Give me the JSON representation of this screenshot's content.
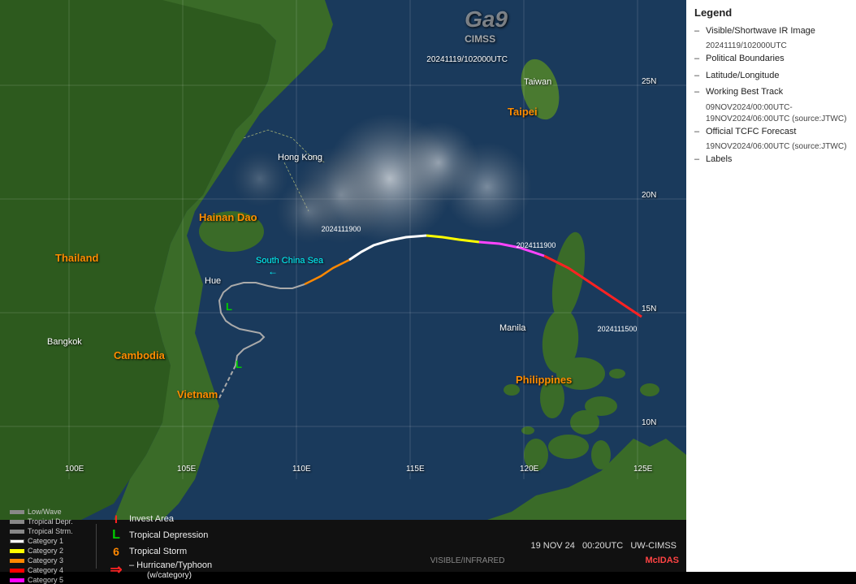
{
  "legend": {
    "title": "Legend",
    "items": [
      {
        "id": "visible-ir",
        "label": "Visible/Shortwave IR Image",
        "sub": "20241119/102000UTC"
      },
      {
        "id": "political",
        "label": "Political Boundaries"
      },
      {
        "id": "latlng",
        "label": "Latitude/Longitude"
      },
      {
        "id": "best-track",
        "label": "Working Best Track",
        "sub": "09NOV2024/00:00UTC-\n19NOV2024/06:00UTC  (source:JTWC)"
      },
      {
        "id": "official-forecast",
        "label": "Official TCFC Forecast",
        "sub": "19NOV2024/06:00UTC  (source:JTWC)"
      },
      {
        "id": "labels",
        "label": "Labels"
      }
    ]
  },
  "map": {
    "labels": [
      {
        "id": "taiwan",
        "text": "Taiwan",
        "color": "orange"
      },
      {
        "id": "taipei",
        "text": "Taipei",
        "color": "white"
      },
      {
        "id": "hong-kong",
        "text": "Hong Kong",
        "color": "white"
      },
      {
        "id": "hainan-dao",
        "text": "Hainan Dao",
        "color": "orange"
      },
      {
        "id": "south-china-sea",
        "text": "South China Sea",
        "color": "cyan"
      },
      {
        "id": "hue",
        "text": "Hue",
        "color": "white"
      },
      {
        "id": "thailand",
        "text": "Thailand",
        "color": "orange"
      },
      {
        "id": "bangkok",
        "text": "Bangkok",
        "color": "white"
      },
      {
        "id": "cambodia",
        "text": "Cambodia",
        "color": "orange"
      },
      {
        "id": "vietnam",
        "text": "Vietnam",
        "color": "orange"
      },
      {
        "id": "philippines",
        "text": "Philippines",
        "color": "orange"
      },
      {
        "id": "manila",
        "text": "Manila",
        "color": "white"
      },
      {
        "id": "25N",
        "text": "25N",
        "color": "white"
      },
      {
        "id": "20N",
        "text": "20N",
        "color": "white"
      },
      {
        "id": "15N",
        "text": "15N",
        "color": "white"
      },
      {
        "id": "100E",
        "text": "100E",
        "color": "white"
      },
      {
        "id": "105E",
        "text": "105E",
        "color": "white"
      },
      {
        "id": "110E",
        "text": "110E",
        "color": "white"
      },
      {
        "id": "115E",
        "text": "115E",
        "color": "white"
      },
      {
        "id": "120E",
        "text": "120E",
        "color": "white"
      },
      {
        "id": "125E",
        "text": "125E",
        "color": "white"
      },
      {
        "id": "ts1",
        "text": "2024111900",
        "color": "white"
      },
      {
        "id": "ts2",
        "text": "2024111900",
        "color": "white"
      },
      {
        "id": "ts3",
        "text": "2024111500",
        "color": "white"
      }
    ],
    "timestamp_label": "20241119/102000UTC",
    "cimss_text": "CIMSS"
  },
  "bottom_bar": {
    "type": "VISIBLE/INFRARED",
    "date": "19 NOV 24",
    "time": "00:20UTC",
    "source": "UW-CIMSS",
    "mcidas": "McIDAS"
  },
  "track_legend": {
    "categories": [
      {
        "label": "Low/Wave",
        "color": "#888888"
      },
      {
        "label": "Tropical Depr.",
        "color": "#888888"
      },
      {
        "label": "Tropical Strm.",
        "color": "#888888"
      },
      {
        "label": "Category 1",
        "color": "#ffffff"
      },
      {
        "label": "Category 2",
        "color": "#ffff00"
      },
      {
        "label": "Category 3",
        "color": "#ff8800"
      },
      {
        "label": "Category 4",
        "color": "#ff0000"
      },
      {
        "label": "Category 5",
        "color": "#ff00ff"
      }
    ],
    "symbols": [
      {
        "symbol": "I",
        "label": "Invest Area",
        "color": "#ff2222"
      },
      {
        "symbol": "L",
        "label": "Tropical Depression",
        "color": "#00dd00"
      },
      {
        "symbol": "6",
        "label": "Tropical Storm",
        "color": "#ff8800"
      },
      {
        "symbol": "→",
        "label": "Hurricane/Typhoon\n(w/category)",
        "color": "#ff2222"
      }
    ]
  }
}
